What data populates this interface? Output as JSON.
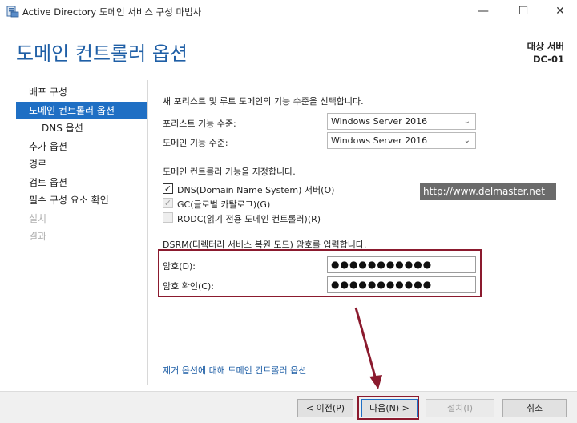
{
  "window": {
    "title": "Active Directory 도메인 서비스 구성 마법사",
    "minimize": "—",
    "maximize": "☐",
    "close": "✕"
  },
  "header": {
    "heading": "도메인 컨트롤러 옵션",
    "target_label": "대상 서버",
    "target_server": "DC-01"
  },
  "sidebar": {
    "items": [
      {
        "label": "배포 구성"
      },
      {
        "label": "도메인 컨트롤러 옵션"
      },
      {
        "label": "DNS 옵션"
      },
      {
        "label": "추가 옵션"
      },
      {
        "label": "경로"
      },
      {
        "label": "검토 옵션"
      },
      {
        "label": "필수 구성 요소 확인"
      },
      {
        "label": "설치"
      },
      {
        "label": "결과"
      }
    ]
  },
  "main": {
    "functional_level_title": "새 포리스트 및 루트 도메인의 기능 수준을 선택합니다.",
    "forest_level_label": "포리스트 기능 수준:",
    "forest_level_value": "Windows Server 2016",
    "domain_level_label": "도메인 기능 수준:",
    "domain_level_value": "Windows Server 2016",
    "capabilities_title": "도메인 컨트롤러 기능을 지정합니다.",
    "dns_option": "DNS(Domain Name System) 서버(O)",
    "gc_option": "GC(글로벌 카탈로그)(G)",
    "rodc_option": "RODC(읽기 전용 도메인 컨트롤러)(R)",
    "dns_checked": true,
    "gc_checked": true,
    "rodc_checked": false,
    "dsrm_title": "DSRM(디렉터리 서비스 복원 모드) 암호를 입력합니다.",
    "password_label": "암호(D):",
    "password_value": "●●●●●●●●●●●",
    "confirm_label": "암호 확인(C):",
    "confirm_value": "●●●●●●●●●●●",
    "help_link": "제거 옵션에 대해 도메인 컨트롤러 옵션"
  },
  "watermark": "http://www.delmaster.net",
  "footer": {
    "prev": "< 이전(P)",
    "next": "다음(N) >",
    "install": "설치(I)",
    "cancel": "취소"
  },
  "colors": {
    "accent": "#1f6fc4",
    "heading": "#1f5fa6",
    "highlight": "#8b1a2e"
  },
  "icons": {
    "app": "server-manager-icon",
    "dropdown": "chevron-down-icon",
    "check": "checkmark-icon"
  }
}
